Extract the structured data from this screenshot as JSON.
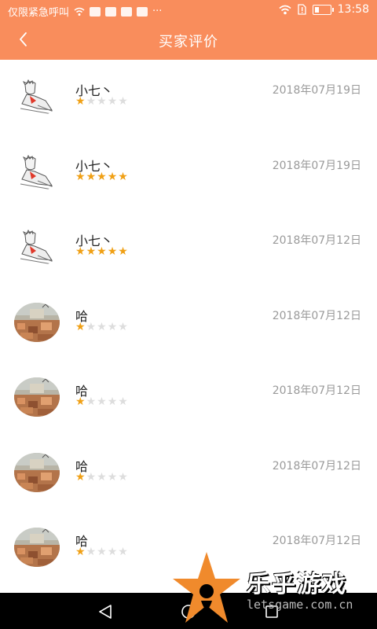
{
  "status_bar": {
    "carrier_text": "仅限紧急呼叫",
    "time": "13:58",
    "more": "···"
  },
  "header": {
    "title": "买家评价"
  },
  "reviews": [
    {
      "name": "小七丶",
      "date": "2018年07月19日",
      "rating": 1,
      "avatar": "sketch-avatar"
    },
    {
      "name": "小七丶",
      "date": "2018年07月19日",
      "rating": 5,
      "avatar": "sketch-avatar"
    },
    {
      "name": "小七丶",
      "date": "2018年07月12日",
      "rating": 5,
      "avatar": "sketch-avatar"
    },
    {
      "name": "哈",
      "date": "2018年07月12日",
      "rating": 1,
      "avatar": "city-photo-avatar"
    },
    {
      "name": "哈",
      "date": "2018年07月12日",
      "rating": 1,
      "avatar": "city-photo-avatar"
    },
    {
      "name": "哈",
      "date": "2018年07月12日",
      "rating": 1,
      "avatar": "city-photo-avatar"
    },
    {
      "name": "哈",
      "date": "2018年07月12日",
      "rating": 1,
      "avatar": "city-photo-avatar"
    }
  ],
  "watermark": {
    "brand": "乐乎游戏",
    "url": "letsgame.com.cn"
  },
  "colors": {
    "header": "#f98d5c",
    "star_on": "#f0a015",
    "star_off": "#dddddd"
  }
}
